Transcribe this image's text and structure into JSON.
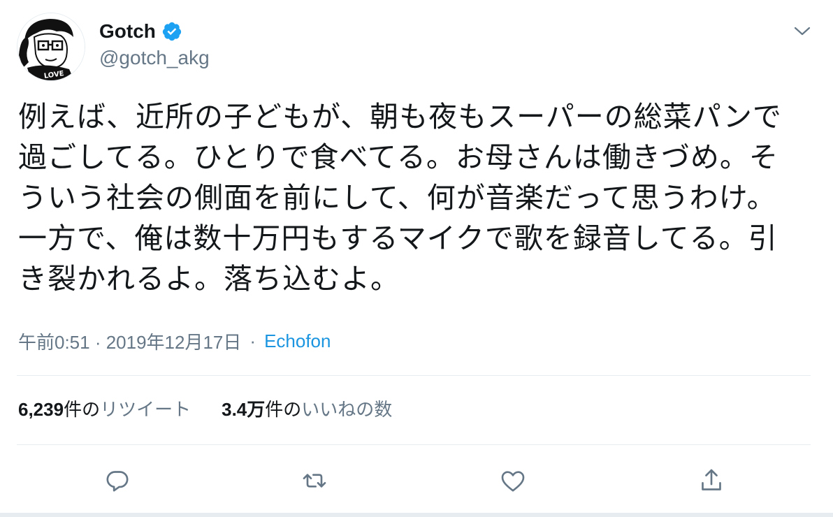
{
  "user": {
    "display_name": "Gotch",
    "handle": "@gotch_akg",
    "avatar_text": "LOVE",
    "verified": true
  },
  "tweet": {
    "text": "例えば、近所の子どもが、朝も夜もスーパーの総菜パンで過ごしてる。ひとりで食べてる。お母さんは働きづめ。そういう社会の側面を前にして、何が音楽だって思うわけ。一方で、俺は数十万円もするマイクで歌を録音してる。引き裂かれるよ。落ち込むよ。",
    "timestamp": "午前0:51 · 2019年12月17日",
    "separator": "·",
    "source": "Echofon"
  },
  "stats": {
    "retweets_count": "6,239",
    "retweets_label_prefix": "件の",
    "retweets_label": "リツイート",
    "likes_count": "3.4万",
    "likes_label_prefix": "件の",
    "likes_label": "いいねの数"
  },
  "colors": {
    "text": "#14171a",
    "secondary": "#657786",
    "link": "#1b95e0",
    "verified": "#1da1f2",
    "divider": "#e6ecf0"
  },
  "icons": {
    "caret": "chevron-down-icon",
    "reply": "reply-icon",
    "retweet": "retweet-icon",
    "like": "heart-icon",
    "share": "share-icon",
    "verified": "verified-badge-icon"
  }
}
